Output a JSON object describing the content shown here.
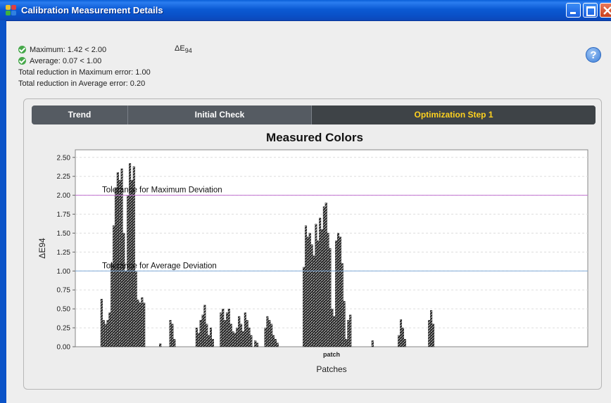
{
  "window": {
    "title": "Calibration Measurement Details"
  },
  "summary": {
    "max_line": "Maximum: 1.42 < 2.00",
    "avg_line": "Average: 0.07 < 1.00",
    "total_max": "Total reduction in Maximum error: 1.00",
    "total_avg": "Total reduction in Average error: 0.20",
    "metric_base": "ΔE",
    "metric_sub": "94"
  },
  "help": {
    "label": "?"
  },
  "tabs": [
    {
      "label": "Trend"
    },
    {
      "label": "Initial Check"
    },
    {
      "label": "Optimization Step 1"
    }
  ],
  "colors": {
    "accent_tab_text": "#ffd21f",
    "max_line": "#c070d0",
    "avg_line": "#7ea9d8"
  },
  "chart_data": {
    "type": "bar",
    "title": "Measured Colors",
    "xlabel": "Patches",
    "ylabel": "ΔE94",
    "x_tick": "patch",
    "ylim": [
      0,
      2.6
    ],
    "yticks": [
      "0.00",
      "0.25",
      "0.50",
      "0.75",
      "1.00",
      "1.25",
      "1.50",
      "1.75",
      "2.00",
      "2.25",
      "2.50"
    ],
    "grid": true,
    "reference_lines": [
      {
        "name": "Tolerance for Maximum Deviation",
        "value": 2.0
      },
      {
        "name": "Tolerance for Average Deviation",
        "value": 1.0
      }
    ],
    "series": [
      {
        "values": [
          0.63,
          0.35,
          0.3,
          0.35,
          0.45,
          1.1,
          1.6,
          2.1,
          2.3,
          2.2,
          2.35,
          1.5,
          1.0,
          2.0,
          2.42,
          2.2,
          2.38,
          1.0,
          0.62,
          0.58,
          0.65,
          0.58,
          0,
          0,
          0,
          0,
          0,
          0,
          0,
          0.04,
          0,
          0,
          0,
          0,
          0.35,
          0.3,
          0.1,
          0,
          0,
          0,
          0,
          0,
          0,
          0,
          0,
          0,
          0,
          0.25,
          0.18,
          0.35,
          0.42,
          0.55,
          0.3,
          0.15,
          0.25,
          0.1,
          0,
          0,
          0,
          0.45,
          0.5,
          0.35,
          0.45,
          0.5,
          0.3,
          0.2,
          0.18,
          0.25,
          0.4,
          0.3,
          0.2,
          0.45,
          0.35,
          0.25,
          0.15,
          0,
          0.08,
          0.05,
          0,
          0,
          0,
          0.25,
          0.4,
          0.35,
          0.3,
          0.15,
          0.1,
          0.05,
          0,
          0,
          0,
          0,
          0,
          0,
          0,
          0,
          0,
          0,
          0,
          0,
          1.05,
          1.6,
          1.45,
          1.5,
          1.35,
          1.2,
          1.62,
          1.4,
          1.7,
          1.55,
          1.85,
          1.9,
          1.5,
          1.3,
          0.5,
          0.4,
          1.4,
          1.5,
          1.45,
          1.1,
          0.6,
          0.1,
          0.35,
          0.42,
          0,
          0,
          0,
          0,
          0,
          0,
          0,
          0,
          0,
          0,
          0.08,
          0,
          0,
          0,
          0,
          0,
          0,
          0,
          0,
          0,
          0,
          0,
          0,
          0.15,
          0.36,
          0.25,
          0.1,
          0,
          0,
          0,
          0,
          0,
          0,
          0,
          0,
          0,
          0,
          0,
          0.35,
          0.48,
          0.3
        ]
      }
    ]
  }
}
